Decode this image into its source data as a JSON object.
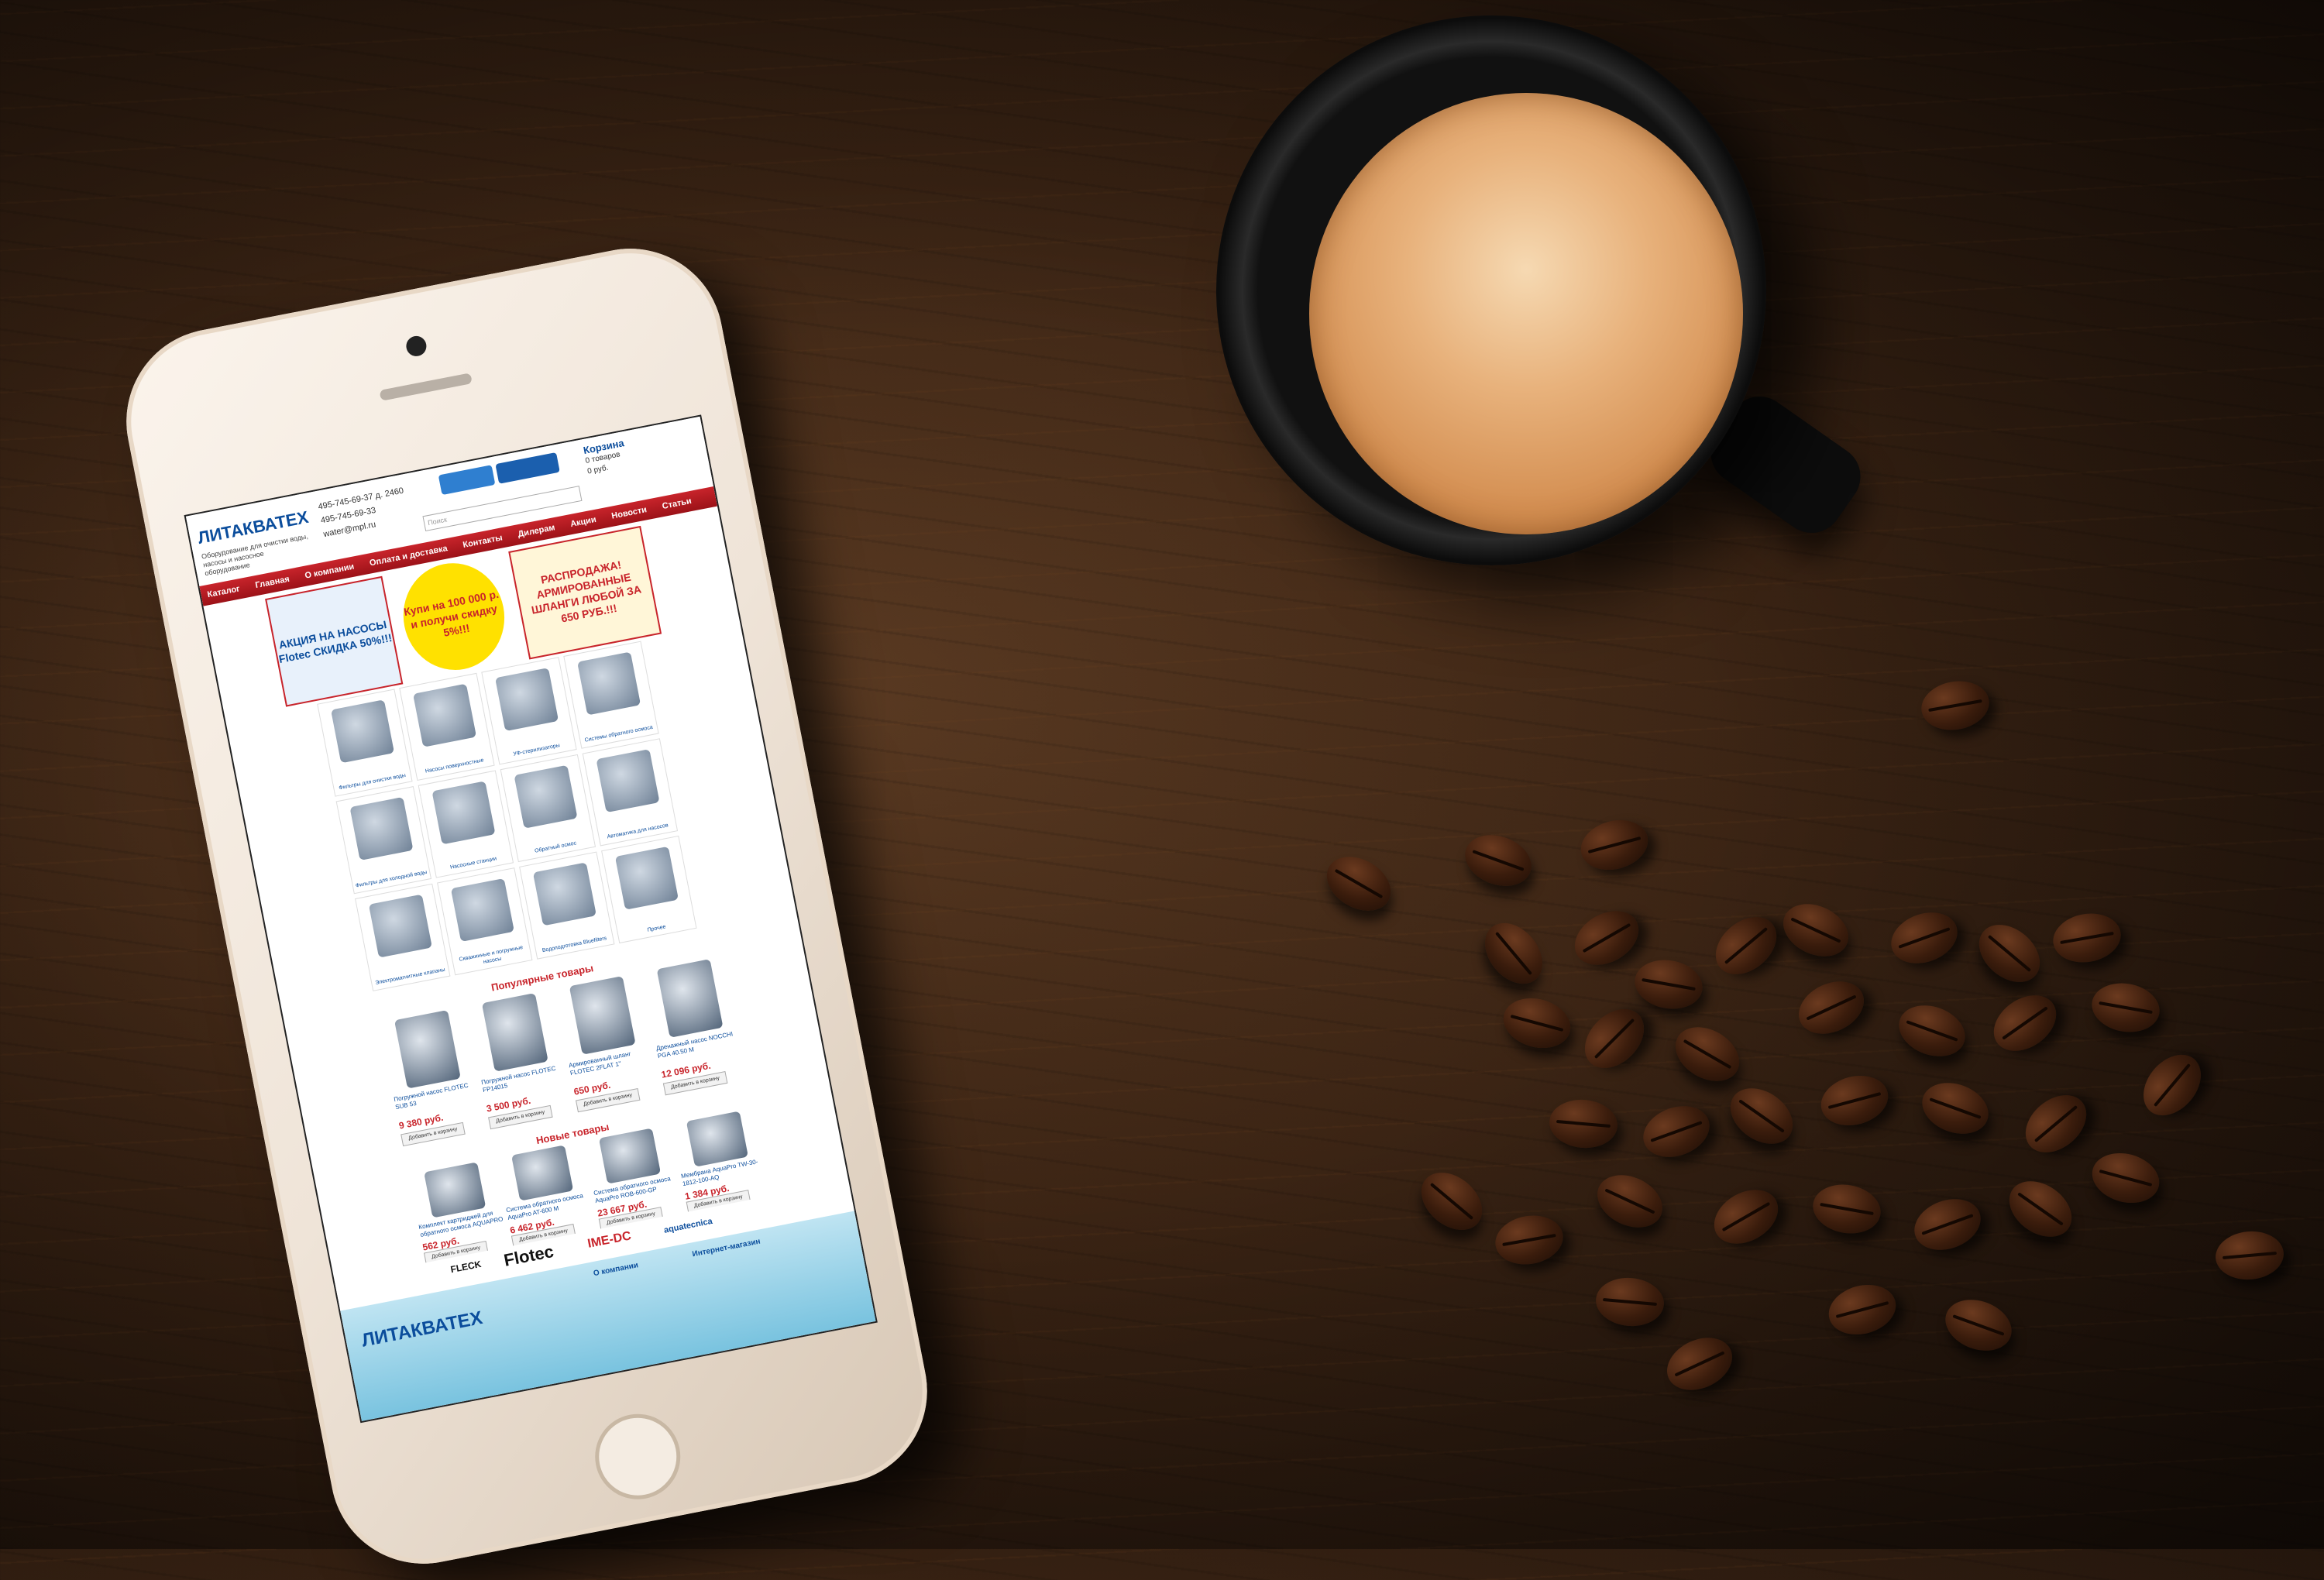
{
  "site": {
    "logo": "ЛИТАКВАТЕХ",
    "tagline": "Оборудование для очистки воды, насосы и насосное оборудование",
    "phone_1": "495-745-69-37 д. 2460",
    "phone_2": "495-745-69-33",
    "email": "water@mpl.ru",
    "search_placeholder": "Поиск",
    "cart": {
      "title": "Корзина",
      "items": "0 товаров",
      "sum": "0 руб."
    },
    "nav": [
      "Каталог",
      "Главная",
      "О компании",
      "Оплата и доставка",
      "Контакты",
      "Дилерам",
      "Акции",
      "Новости",
      "Статьи"
    ],
    "banners": {
      "left": "АКЦИЯ НА НАСОСЫ Flotec СКИДКА 50%!!!",
      "middle": "Купи на 100 000 р. и получи скидку 5%!!!",
      "right": "РАСПРОДАЖА! АРМИРОВАННЫЕ ШЛАНГИ ЛЮБОЙ ЗА 650 РУБ.!!!"
    },
    "categories": [
      "Фильтры для очистки воды",
      "Насосы поверхностные",
      "УФ-стерилизаторы",
      "Системы обратного осмоса",
      "Фильтры для холодной воды",
      "Насосные станции",
      "Обратный осмос",
      "Автоматика для насосов",
      "Электромагнитные клапаны",
      "Скважинные и погружные насосы",
      "Водоподготовка Bluefilters",
      "Прочее"
    ],
    "popular_title": "Популярные товары",
    "popular": [
      {
        "name": "Погружной насос FLOTEC SUB 53",
        "price": "9 380 руб.",
        "add": "Добавить в корзину"
      },
      {
        "name": "Погружной насос FLOTEC FP14015",
        "price": "3 500 руб.",
        "add": "Добавить в корзину"
      },
      {
        "name": "Армированный шланг FLOTEC 2FLAT 1\"",
        "price": "650 руб.",
        "add": "Добавить в корзину"
      },
      {
        "name": "Дренажный насос NOCCHI PGA 40.50 M",
        "price": "12 096 руб.",
        "add": "Добавить в корзину"
      }
    ],
    "new_title": "Новые товары",
    "new": [
      {
        "name": "Комплект картриджей для обратного осмоса AQUAPRO",
        "price": "562 руб.",
        "add": "Добавить в корзину"
      },
      {
        "name": "Система обратного осмоса AquaPro AT-600 M",
        "price": "6 462 руб.",
        "add": "Добавить в корзину"
      },
      {
        "name": "Система обратного осмоса AquaPro ROB-600-GP",
        "price": "23 667 руб.",
        "add": "Добавить в корзину"
      },
      {
        "name": "Мембрана AquaPro TW-30-1812-100-AQ",
        "price": "1 384 руб.",
        "add": "Добавить в корзину"
      }
    ],
    "brands": [
      "FLECK",
      "Flotec",
      "IME-DC",
      "aquatecnica"
    ],
    "footer": {
      "logo": "ЛИТАКВАТЕХ",
      "col_1": "О компании",
      "col_2": "Интернет-магазин"
    }
  },
  "colors": {
    "accent_red": "#c8242b",
    "brand_blue": "#0b4d9c",
    "wood": "#3b2414"
  }
}
